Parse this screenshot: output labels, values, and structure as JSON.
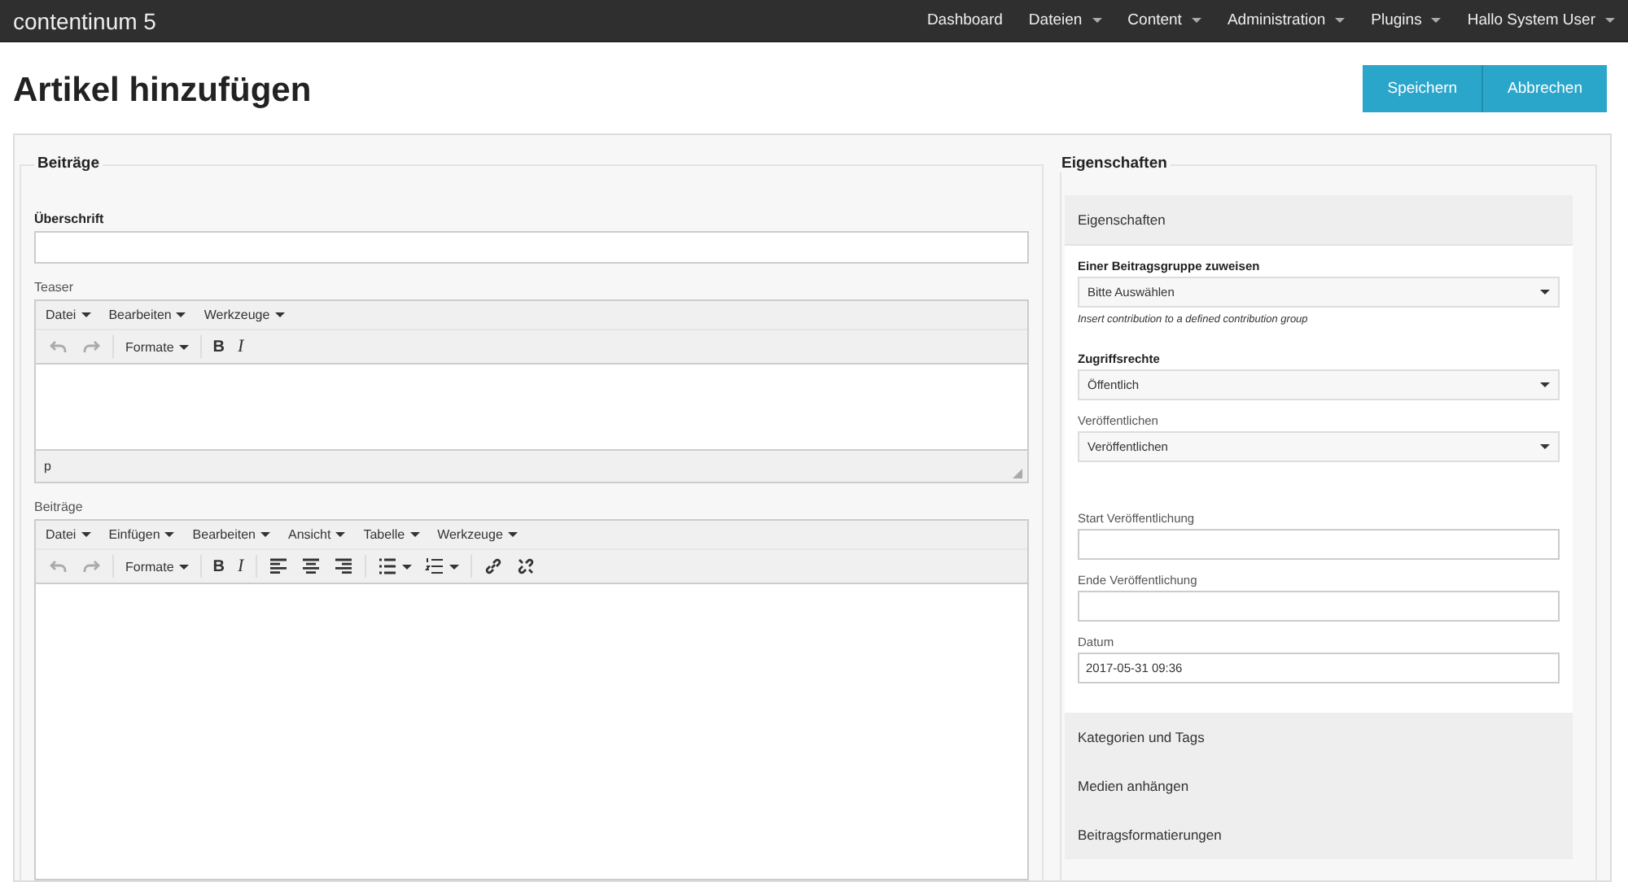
{
  "navbar": {
    "brand": "contentinum 5",
    "items": [
      {
        "label": "Dashboard",
        "dropdown": false
      },
      {
        "label": "Dateien",
        "dropdown": true
      },
      {
        "label": "Content",
        "dropdown": true
      },
      {
        "label": "Administration",
        "dropdown": true
      },
      {
        "label": "Plugins",
        "dropdown": true
      },
      {
        "label": "Hallo System User",
        "dropdown": true
      }
    ]
  },
  "page_title": "Artikel hinzufügen",
  "buttons": [
    "Speichern",
    "Abbrechen"
  ],
  "main": {
    "legend": "Beiträge",
    "heading_field": {
      "label": "Überschrift"
    },
    "editors": [
      {
        "label": "Teaser",
        "menus": [
          "Datei",
          "Bearbeiten",
          "Werkzeuge"
        ],
        "tools": [
          {
            "kind": "undo",
            "disabled": true
          },
          {
            "kind": "redo",
            "disabled": true
          },
          {
            "kind": "sep"
          },
          {
            "kind": "formats",
            "text": "Formate",
            "disabled": false
          },
          {
            "kind": "sep"
          },
          {
            "kind": "bold",
            "text": "B",
            "disabled": false
          },
          {
            "kind": "italic",
            "text": "I",
            "disabled": false
          }
        ],
        "statusbar": "p"
      },
      {
        "label": "Beiträge",
        "menus": [
          "Datei",
          "Einfügen",
          "Bearbeiten",
          "Ansicht",
          "Tabelle",
          "Werkzeuge"
        ],
        "tools": [
          {
            "kind": "undo",
            "disabled": true
          },
          {
            "kind": "redo",
            "disabled": true
          },
          {
            "kind": "sep"
          },
          {
            "kind": "formats",
            "text": "Formate",
            "disabled": false
          },
          {
            "kind": "sep"
          },
          {
            "kind": "bold",
            "text": "B",
            "disabled": false
          },
          {
            "kind": "italic",
            "text": "I",
            "disabled": false
          },
          {
            "kind": "sep"
          },
          {
            "kind": "align-left",
            "disabled": false
          },
          {
            "kind": "align-center",
            "disabled": false
          },
          {
            "kind": "align-right",
            "disabled": false
          },
          {
            "kind": "sep"
          },
          {
            "kind": "bullets",
            "disabled": false
          },
          {
            "kind": "numbers",
            "disabled": false
          },
          {
            "kind": "sep"
          },
          {
            "kind": "link",
            "disabled": false
          },
          {
            "kind": "unlink",
            "disabled": false
          }
        ]
      }
    ]
  },
  "sidebar": {
    "legend": "Eigenschaften",
    "panels": [
      {
        "title": "Eigenschaften",
        "expanded": true,
        "fields": [
          {
            "kind": "select",
            "label": "Einer Beitragsgruppe zuweisen",
            "strong": true,
            "value": "Bitte Auswählen",
            "help": "Insert contribution to a defined contribution group"
          },
          {
            "kind": "select",
            "label": "Zugriffsrechte",
            "strong": true,
            "value": "Öffentlich"
          },
          {
            "kind": "select",
            "label": "Veröffentlichen",
            "strong": false,
            "value": "Veröffentlichen"
          },
          {
            "kind": "spacer"
          },
          {
            "kind": "input",
            "label": "Start Veröffentlichung",
            "strong": false
          },
          {
            "kind": "input",
            "label": "Ende Veröffentlichung",
            "strong": false
          },
          {
            "kind": "input",
            "label": "Datum",
            "strong": false,
            "value": "2017-05-31 09:36"
          }
        ]
      },
      {
        "title": "Kategorien und Tags",
        "expanded": false
      },
      {
        "title": "Medien anhängen",
        "expanded": false
      },
      {
        "title": "Beitragsformatierungen",
        "expanded": false
      }
    ]
  }
}
